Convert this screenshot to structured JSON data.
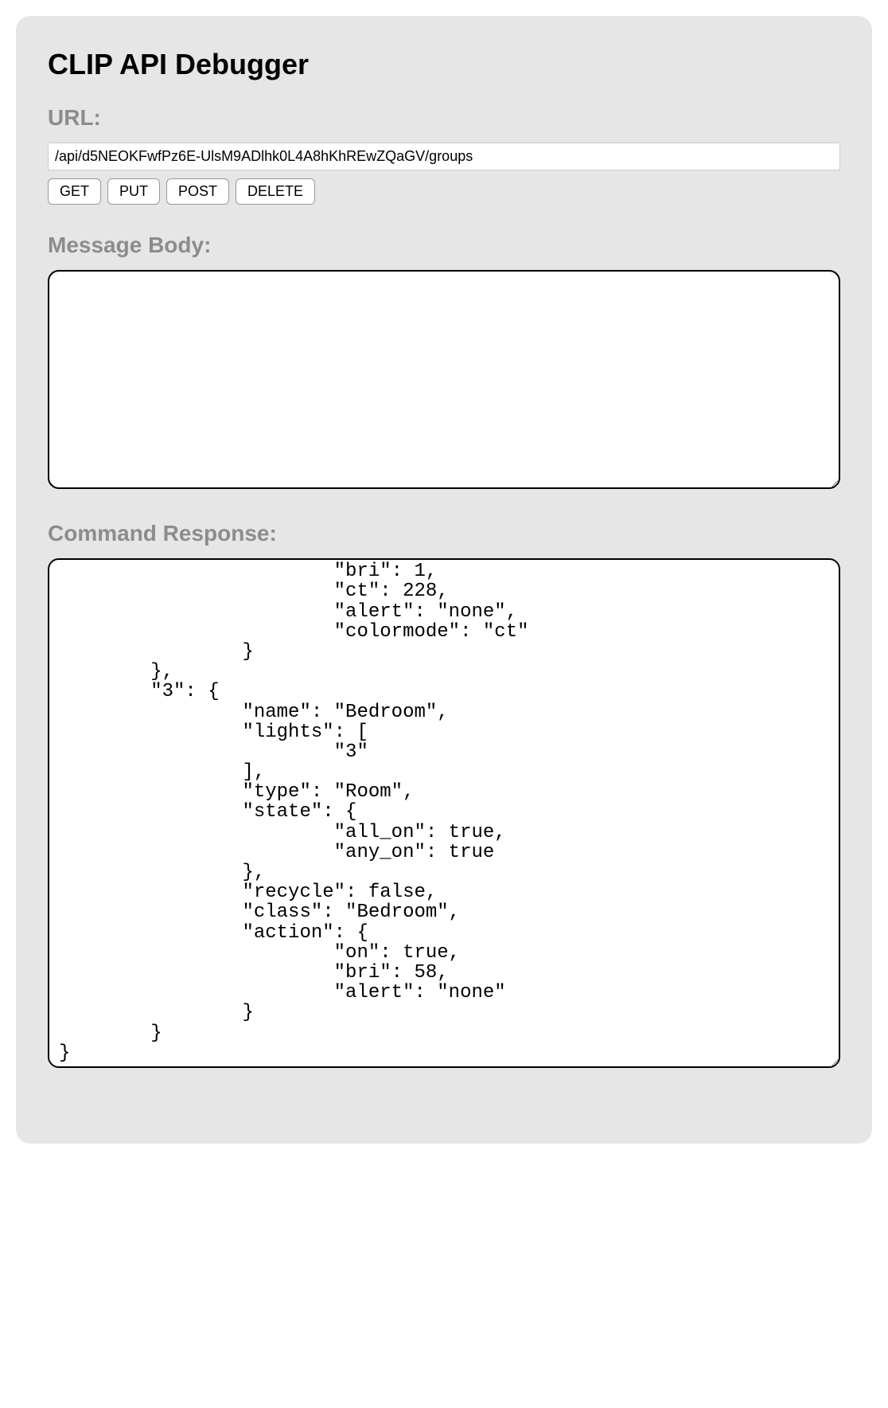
{
  "header": {
    "title": "CLIP API Debugger"
  },
  "url_section": {
    "label": "URL:",
    "value": "/api/d5NEOKFwfPz6E-UlsM9ADlhk0L4A8hKhREwZQaGV/groups"
  },
  "buttons": {
    "get": "GET",
    "put": "PUT",
    "post": "POST",
    "delete": "DELETE"
  },
  "message_body": {
    "label": "Message Body:",
    "value": ""
  },
  "response": {
    "label": "Command Response:",
    "text": "                        \"on\": false,\n                        \"bri\": 1,\n                        \"ct\": 228,\n                        \"alert\": \"none\",\n                        \"colormode\": \"ct\"\n                }\n        },\n        \"3\": {\n                \"name\": \"Bedroom\",\n                \"lights\": [\n                        \"3\"\n                ],\n                \"type\": \"Room\",\n                \"state\": {\n                        \"all_on\": true,\n                        \"any_on\": true\n                },\n                \"recycle\": false,\n                \"class\": \"Bedroom\",\n                \"action\": {\n                        \"on\": true,\n                        \"bri\": 58,\n                        \"alert\": \"none\"\n                }\n        }\n}"
  }
}
